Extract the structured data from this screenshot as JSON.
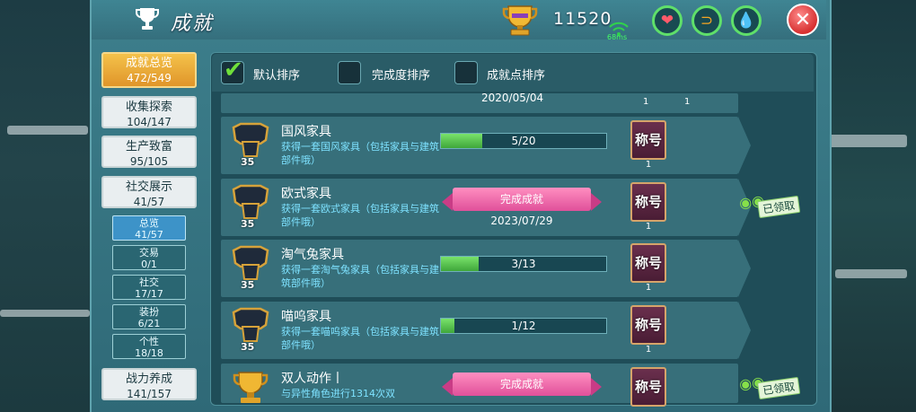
{
  "header": {
    "title": "成就",
    "points": "11520",
    "ping": "68ms"
  },
  "colors": {
    "accent_gold": "#e8a83a",
    "progress_green": "#5fd25a",
    "ribbon_pink": "#e0509a",
    "cyan_text": "#7ee2ff"
  },
  "header_icons": [
    "trophy-icon",
    "heart-icon",
    "stomach-icon",
    "water-drop-icon",
    "close-icon"
  ],
  "sidebar": {
    "items": [
      {
        "label": "成就总览",
        "count": "472/549"
      },
      {
        "label": "收集探索",
        "count": "104/147"
      },
      {
        "label": "生产致富",
        "count": "95/105"
      },
      {
        "label": "社交展示",
        "count": "41/57"
      },
      {
        "label": "战力养成",
        "count": "141/157"
      }
    ],
    "subitems": [
      {
        "label": "总览",
        "count": "41/57"
      },
      {
        "label": "交易",
        "count": "0/1"
      },
      {
        "label": "社交",
        "count": "17/17"
      },
      {
        "label": "装扮",
        "count": "6/21"
      },
      {
        "label": "个性",
        "count": "18/18"
      }
    ]
  },
  "sort": {
    "default_label": "默认排序",
    "completion_label": "完成度排序",
    "points_label": "成就点排序",
    "default_checked": true
  },
  "partial_row": {
    "date": "2020/05/04",
    "qty1": "1",
    "qty2": "1"
  },
  "achievements": [
    {
      "name": "国风家具",
      "desc": "获得一套国风家具（包括家具与建筑部件哦）",
      "level": "35",
      "progress_text": "5/20",
      "progress": 0.25,
      "completed": false,
      "reward": "称号",
      "reward_qty": "1",
      "claimed": false
    },
    {
      "name": "欧式家具",
      "desc": "获得一套欧式家具（包括家具与建筑部件哦）",
      "level": "35",
      "status": "完成成就",
      "date": "2023/07/29",
      "completed": true,
      "reward": "称号",
      "reward_qty": "1",
      "claimed": true,
      "claimed_label": "已领取"
    },
    {
      "name": "淘气兔家具",
      "desc": "获得一套淘气兔家具（包括家具与建筑部件哦）",
      "level": "35",
      "progress_text": "3/13",
      "progress": 0.23,
      "completed": false,
      "reward": "称号",
      "reward_qty": "1",
      "claimed": false
    },
    {
      "name": "喵呜家具",
      "desc": "获得一套喵呜家具（包括家具与建筑部件哦）",
      "level": "35",
      "progress_text": "1/12",
      "progress": 0.08,
      "completed": false,
      "reward": "称号",
      "reward_qty": "1",
      "claimed": false
    },
    {
      "name": "双人动作丨",
      "desc": "与异性角色进行1314次双",
      "status": "完成成就",
      "completed": true,
      "reward": "称号",
      "claimed": true,
      "claimed_label": "已领取"
    }
  ]
}
